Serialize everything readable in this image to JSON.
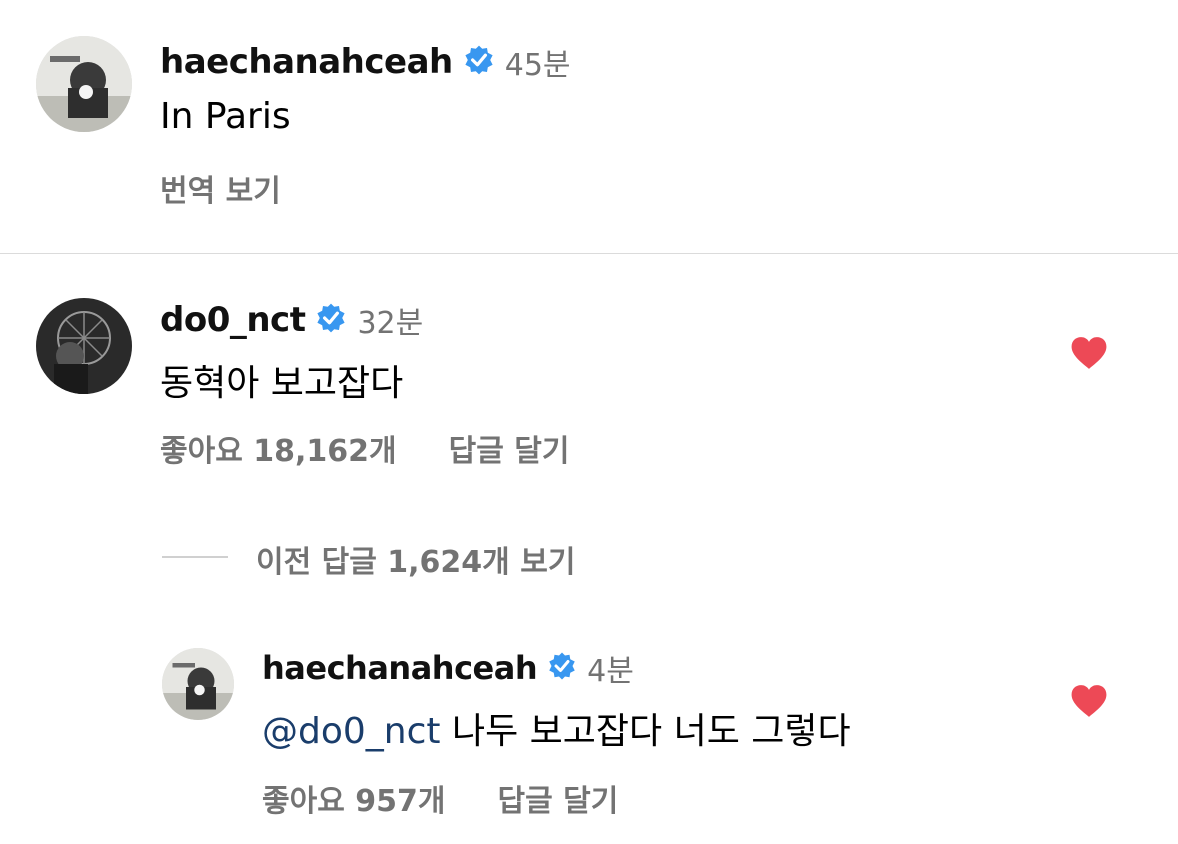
{
  "comments": [
    {
      "username": "haechanahceah",
      "time": "45분",
      "text": "In Paris",
      "action": "번역 보기"
    },
    {
      "username": "do0_nct",
      "time": "32분",
      "text": "동혁아 보고잡다",
      "likes": "좋아요 18,162개",
      "reply_label": "답글 달기"
    }
  ],
  "view_replies": "이전 답글 1,624개 보기",
  "reply": {
    "username": "haechanahceah",
    "time": "4분",
    "mention": "@do0_nct",
    "text": "나두 보고잡다 너도 그렇다",
    "likes": "좋아요 957개",
    "reply_label": "답글 달기"
  },
  "colors": {
    "verified": "#3897f0",
    "heart": "#ed4956",
    "mention": "#1a3d6b",
    "muted": "#737373"
  },
  "icons": [
    "verified-badge-icon",
    "heart-icon"
  ]
}
